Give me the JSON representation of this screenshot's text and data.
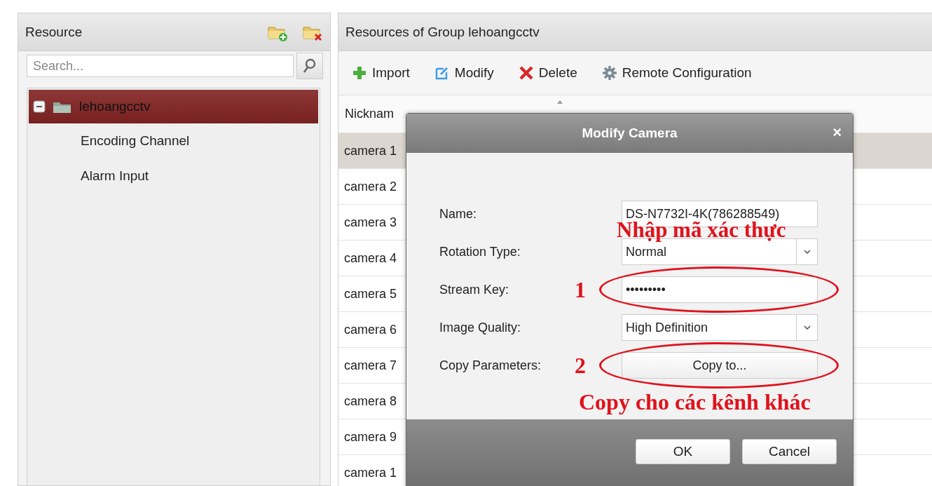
{
  "sidebar": {
    "title": "Resource",
    "search": {
      "placeholder": "Search..."
    },
    "tree": [
      {
        "label": "lehoangcctv",
        "expanded": true,
        "selected": true,
        "children": [
          {
            "label": "Encoding Channel",
            "selected": false
          },
          {
            "label": "Alarm Input",
            "selected": false
          }
        ]
      }
    ]
  },
  "main": {
    "title": "Resources of Group lehoangcctv",
    "toolbar": [
      {
        "label": "Import",
        "kind": "add"
      },
      {
        "label": "Modify",
        "kind": "edit"
      },
      {
        "label": "Delete",
        "kind": "delete"
      },
      {
        "label": "Remote Configuration",
        "kind": "settings"
      }
    ],
    "table": {
      "columns": [
        "Nicknam"
      ],
      "rows": [
        {
          "cells": [
            "camera 1"
          ],
          "selected": true
        },
        {
          "cells": [
            "camera 2"
          ],
          "selected": false
        },
        {
          "cells": [
            "camera 3"
          ],
          "selected": false
        },
        {
          "cells": [
            "camera 4"
          ],
          "selected": false
        },
        {
          "cells": [
            "camera 5"
          ],
          "selected": false
        },
        {
          "cells": [
            "camera 6"
          ],
          "selected": false
        },
        {
          "cells": [
            "camera 7"
          ],
          "selected": false
        },
        {
          "cells": [
            "camera 8"
          ],
          "selected": false
        },
        {
          "cells": [
            "camera 9"
          ],
          "selected": false
        },
        {
          "cells": [
            "camera 1"
          ],
          "selected": false
        }
      ]
    }
  },
  "dialog": {
    "title": "Modify Camera",
    "close": "×",
    "fields": [
      {
        "label": "Name:",
        "kind": "text",
        "value": "DS-N7732I-4K(786288549)",
        "circled": false
      },
      {
        "label": "Rotation Type:",
        "kind": "select",
        "value": "Normal",
        "circled": false
      },
      {
        "label": "Stream Key:",
        "kind": "password",
        "value": "•••••••••",
        "marker": "1",
        "circled": true
      },
      {
        "label": "Image Quality:",
        "kind": "select",
        "value": "High Definition",
        "circled": false
      },
      {
        "label": "Copy Parameters:",
        "kind": "button",
        "value": "Copy to...",
        "marker": "2",
        "circled": true
      }
    ],
    "buttons": [
      "OK",
      "Cancel"
    ]
  },
  "annotations": [
    {
      "text": "Nhập mã xác thực",
      "kind": "upper"
    },
    {
      "text": "Copy cho các kênh khác",
      "kind": "lower"
    }
  ]
}
